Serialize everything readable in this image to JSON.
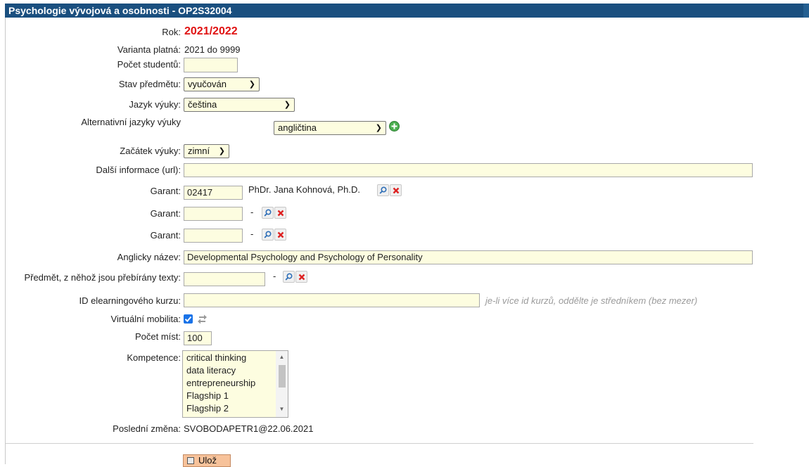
{
  "title": "Psychologie vývojová a osobnosti - OP2S32004",
  "fields": {
    "rok_label": "Rok:",
    "rok_value": "2021/2022",
    "varianta_label": "Varianta platná:",
    "varianta_value": "2021 do 9999",
    "pocet_studentu_label": "Počet studentů:",
    "pocet_studentu_value": "",
    "stav_label": "Stav předmětu:",
    "stav_value": "vyučován",
    "jazyk_label": "Jazyk výuky:",
    "jazyk_value": "čeština",
    "alt_jazyky_label": "Alternativní jazyky výuky",
    "alt_jazyky_value": "angličtina",
    "zacatek_label": "Začátek výuky:",
    "zacatek_value": "zimní",
    "dalsi_info_label": "Další informace (url):",
    "dalsi_info_value": "",
    "garant_label": "Garant:",
    "garant1_code": "02417",
    "garant1_name": "PhDr. Jana Kohnová, Ph.D.",
    "garant2_code": "",
    "garant3_code": "",
    "dash": "-",
    "anglicky_label": "Anglicky název:",
    "anglicky_value": "Developmental Psychology and Psychology of Personality",
    "predmet_texty_label": "Předmět, z něhož jsou přebírány texty:",
    "predmet_texty_value": "",
    "elearning_label": "ID elearningového kurzu:",
    "elearning_value": "",
    "elearning_hint": "je-li více id kurzů, oddělte je středníkem (bez mezer)",
    "virtualni_label": "Virtuální mobilita:",
    "virtualni_checked": true,
    "pocet_mist_label": "Počet míst:",
    "pocet_mist_value": "100",
    "kompetence_label": "Kompetence:",
    "kompetence_options": [
      "critical thinking",
      "data literacy",
      "entrepreneurship",
      "Flagship 1",
      "Flagship 2"
    ],
    "posledni_zmena_label": "Poslední změna:",
    "posledni_zmena_value": "SVOBODAPETR1@22.06.2021"
  },
  "save_label": "Ulož",
  "colors": {
    "title_bg": "#1a4f7f",
    "input_bg": "#fdfde0",
    "year": "#e01212",
    "save_bg": "#f7c29a",
    "checkbox": "#1a73e8"
  }
}
